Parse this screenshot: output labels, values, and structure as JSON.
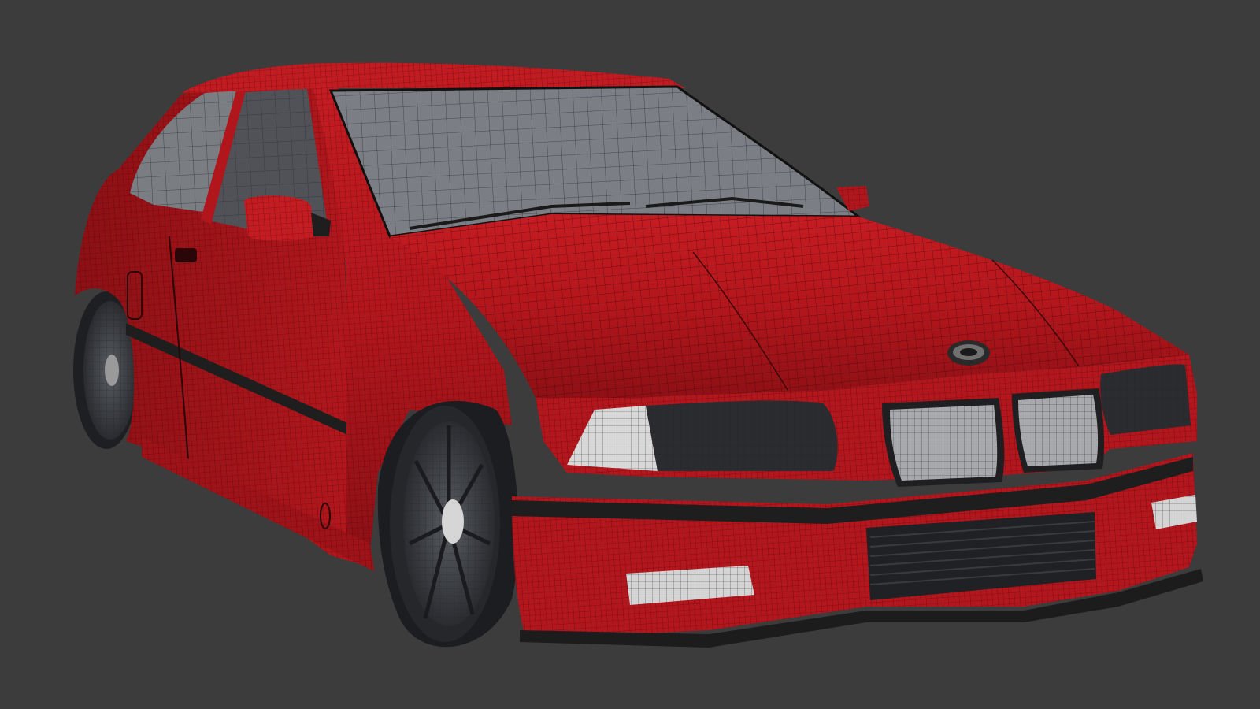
{
  "viewport": {
    "background_color": "#3c3c3c",
    "shading_mode": "wireframe-on-shaded",
    "model": {
      "name": "",
      "body_color": "#b0161c",
      "glass_color": "#7a7d82",
      "wireframe_color": "#1a0505",
      "trim_color": "#1e1e1e",
      "headlight_lens_color": "#d8d8d8",
      "wheel_color": "#3a3d42"
    }
  }
}
